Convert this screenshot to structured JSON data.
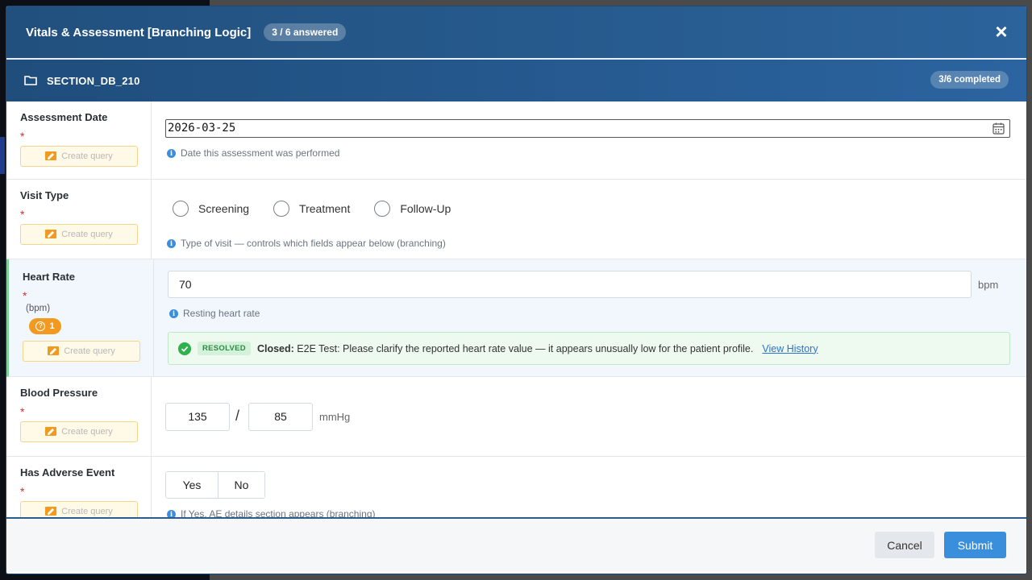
{
  "modal": {
    "title": "Vitals & Assessment [Branching Logic]",
    "answered_badge": "3 / 6 answered",
    "close_icon": "close-icon"
  },
  "section": {
    "name": "SECTION_DB_210",
    "completed_badge": "3/6 completed",
    "icon": "folder-icon"
  },
  "common": {
    "required_mark": "*",
    "create_query_label": "Create query"
  },
  "fields": {
    "assessment_date": {
      "label": "Assessment Date",
      "value": "2026-03-25",
      "hint": "Date this assessment was performed"
    },
    "visit_type": {
      "label": "Visit Type",
      "options": [
        "Screening",
        "Treatment",
        "Follow-Up"
      ],
      "hint": "Type of visit — controls which fields appear below (branching)"
    },
    "heart_rate": {
      "label": "Heart Rate",
      "unit_sub": "(bpm)",
      "query_count": "1",
      "value": "70",
      "unit": "bpm",
      "hint": "Resting heart rate",
      "query": {
        "status": "RESOLVED",
        "closed_label": "Closed:",
        "message": "E2E Test: Please clarify the reported heart rate value — it appears unusually low for the patient profile.",
        "view_history": "View History"
      }
    },
    "blood_pressure": {
      "label": "Blood Pressure",
      "systolic": "135",
      "separator": "/",
      "diastolic": "85",
      "unit": "mmHg"
    },
    "adverse_event": {
      "label": "Has Adverse Event",
      "yes": "Yes",
      "no": "No",
      "hint": "If Yes, AE details section appears (branching)"
    }
  },
  "footer": {
    "cancel": "Cancel",
    "submit": "Submit"
  },
  "colors": {
    "header": "#2b639a",
    "primary": "#3a8fdc",
    "required": "#d0312d",
    "query_badge": "#f29a1f",
    "resolved": "#2fb14d"
  }
}
